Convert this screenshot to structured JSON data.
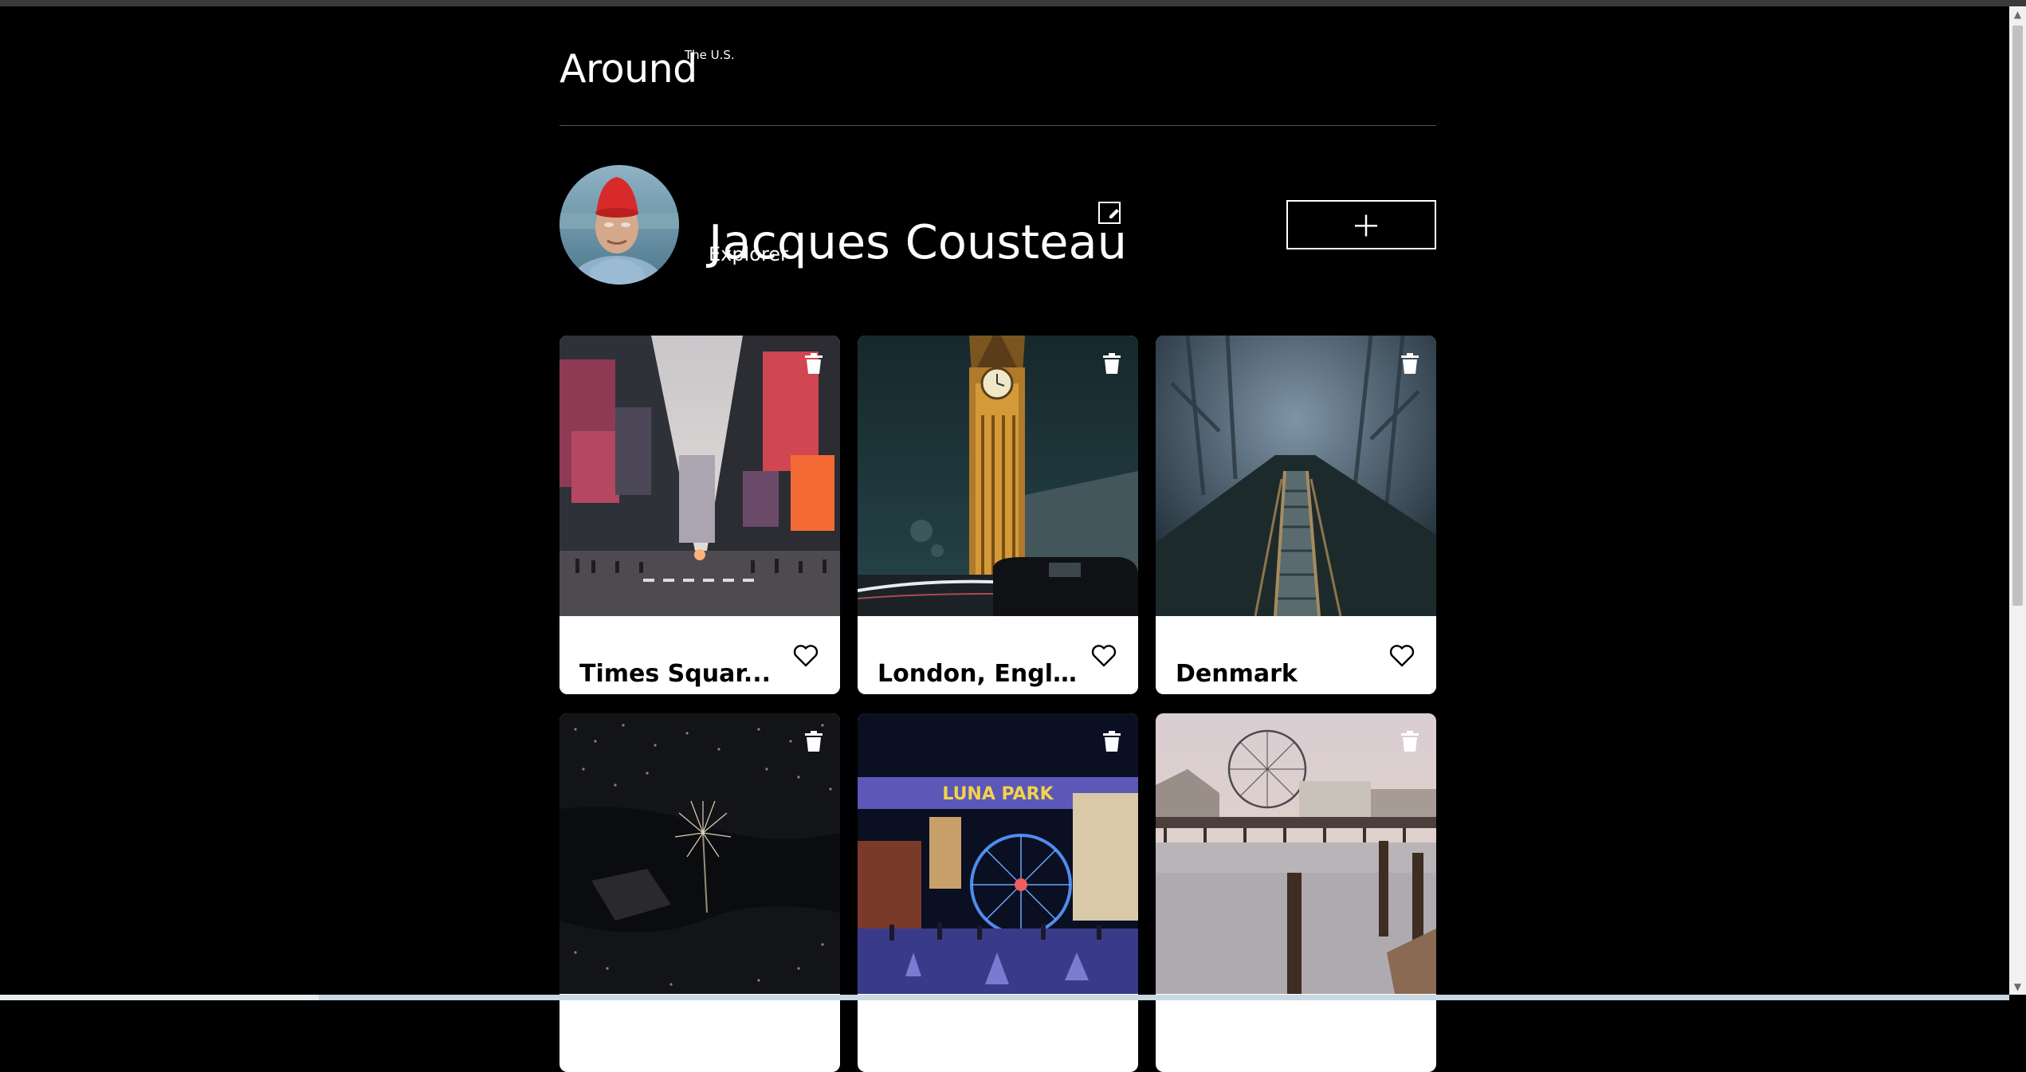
{
  "header": {
    "logo": "Around",
    "logo_sup": "The U.S."
  },
  "profile": {
    "name": "Jacques Cousteau",
    "job": "Explorer",
    "avatar_icon": "avatar-photo",
    "edit_icon": "pencil-icon",
    "add_icon": "plus-icon"
  },
  "cards": [
    {
      "title": "Times Squar...",
      "photo": "times-square-night-street"
    },
    {
      "title": "London, Engl...",
      "photo": "big-ben-clock-tower-night"
    },
    {
      "title": "Denmark",
      "photo": "misty-forest-stairs"
    },
    {
      "title": "",
      "photo": "city-harbor-fireworks-aerial"
    },
    {
      "title": "",
      "photo": "luna-park-ferris-wheel"
    },
    {
      "title": "",
      "photo": "pier-ferris-wheel-sunset"
    }
  ],
  "colors": {
    "background": "#000000",
    "card_caption": "#ffffff",
    "text_dark": "#000000",
    "divider": "#545454"
  }
}
